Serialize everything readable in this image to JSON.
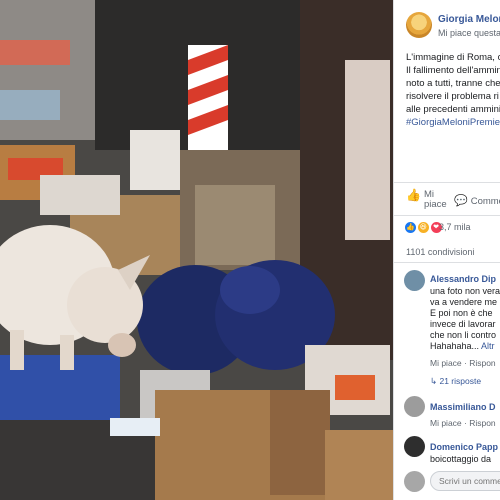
{
  "post": {
    "page_name": "Giorgia Meloni",
    "like_page": "Mi piace questa",
    "caption_lines": [
      "L'immagine di Roma, c",
      "Il fallimento dell'ammin",
      "noto a tutti, tranne che",
      "risolvere il problema ri",
      "alle precedenti ammini"
    ],
    "hashtag": "#GiorgiaMeloniPremie"
  },
  "actions": {
    "like_label_1": "Mi",
    "like_label_2": "piace",
    "comment_label": "Comme"
  },
  "stats": {
    "reaction_count": "3,7 mila",
    "shares": "1101 condivisioni"
  },
  "comments": [
    {
      "name": "Alessandro Dip",
      "lines": [
        "una foto non vera",
        "va a vendere me",
        "E poi non è che",
        "invece di lavorar",
        "che non li contro"
      ],
      "last_line": "Hahahaha... ",
      "more": "Altr",
      "meta": "Mi piace · Rispon",
      "replies": "↳ 21 risposte"
    },
    {
      "name": "Massimiliano D",
      "meta": "Mi piace · Rispon"
    },
    {
      "name": "Domenico Papp",
      "text": "boicottaggio da"
    }
  ],
  "composer": {
    "placeholder": "Scrivi un commento..."
  },
  "colors": {
    "link": "#385898",
    "meta": "#606770",
    "like_reaction": "#1877f2",
    "haha_reaction": "#f7b125",
    "love_reaction": "#f33e58"
  }
}
